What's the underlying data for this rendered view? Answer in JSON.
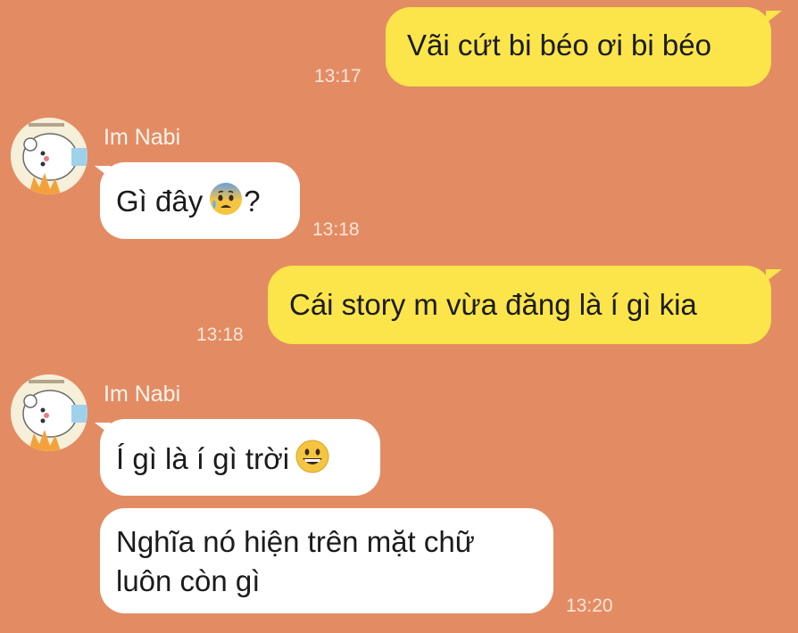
{
  "messages": [
    {
      "sender": "",
      "text": "Vãi cứt bi béo ơi bi béo",
      "time": "13:17"
    },
    {
      "sender": "Im Nabi",
      "text": "Gì đây",
      "suffix": "?",
      "emoji": "anxious-face-with-sweat",
      "time": "13:18"
    },
    {
      "sender": "",
      "text": "Cái story m vừa đăng là í gì kia",
      "time": "13:18"
    },
    {
      "sender": "Im Nabi",
      "text": "Í gì là í gì trời",
      "emoji": "grinning-face",
      "time": ""
    },
    {
      "sender": "",
      "line1": "Nghĩa nó hiện trên mặt chữ",
      "line2": "luôn còn gì",
      "time": "13:20"
    }
  ],
  "colors": {
    "background": "#e38c63",
    "outgoing_bubble": "#fbe54a",
    "incoming_bubble": "#ffffff"
  },
  "avatar": "polar-bear-avatar-icon"
}
